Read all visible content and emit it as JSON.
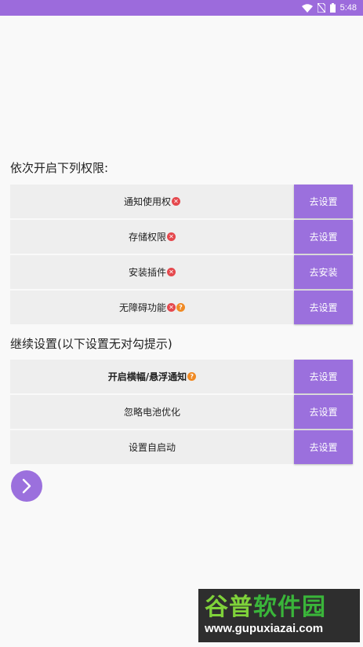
{
  "status_bar": {
    "time": "5:48"
  },
  "section1": {
    "heading": "依次开启下列权限:",
    "rows": [
      {
        "label": "通知使用权",
        "button": "去设置"
      },
      {
        "label": "存储权限",
        "button": "去设置"
      },
      {
        "label": "安装插件",
        "button": "去安装"
      },
      {
        "label": "无障碍功能",
        "button": "去设置"
      }
    ]
  },
  "section2": {
    "heading": "继续设置(以下设置无对勾提示)",
    "rows": [
      {
        "label": "开启横幅/悬浮通知",
        "button": "去设置"
      },
      {
        "label": "忽略电池优化",
        "button": "去设置"
      },
      {
        "label": "设置自启动",
        "button": "去设置"
      }
    ]
  },
  "badges": {
    "error": "✕",
    "help": "?"
  },
  "watermark": {
    "logo_part1": "谷普",
    "logo_part2": "软件园",
    "url": "www.gupuxiazai.com"
  },
  "colors": {
    "accent": "#9b70dd",
    "status_bar": "#9c6bdc",
    "row_bg": "#eeeeee",
    "error": "#e5484d",
    "help": "#f08a24"
  }
}
